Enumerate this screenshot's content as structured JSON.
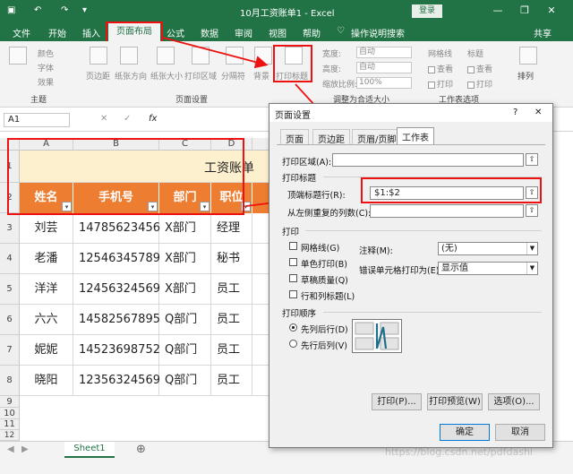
{
  "titlebar": {
    "title": "10月工资账单1  -  Excel",
    "login": "登录",
    "min": "—",
    "restore": "❐",
    "close": "✕"
  },
  "ribbon_tabs": [
    "文件",
    "开始",
    "插入",
    "页面布局",
    "公式",
    "数据",
    "审阅",
    "视图",
    "帮助",
    "操作说明搜索",
    "共享"
  ],
  "ribbon": {
    "theme_items": [
      "颜色",
      "字体",
      "效果",
      "主题"
    ],
    "page_setup_buttons": [
      "页边距",
      "纸张方向",
      "纸张大小",
      "打印区域",
      "分隔符",
      "背景",
      "打印标题"
    ],
    "page_setup_group": "页面设置",
    "scale_labels": [
      "宽度:",
      "高度:",
      "缩放比例:"
    ],
    "scale_values": [
      "自动",
      "自动",
      "100%"
    ],
    "scale_group": "调整为合适大小",
    "sheet_options": [
      "网格线",
      "标题",
      "查看",
      "查看",
      "打印",
      "打印"
    ],
    "sheet_group": "工作表选项",
    "arrange": "排列"
  },
  "formula_bar": {
    "namebox": "A1",
    "fx": "fx"
  },
  "columns": [
    "A",
    "B",
    "C",
    "D"
  ],
  "rows": [
    "1",
    "2",
    "3",
    "4",
    "5",
    "6",
    "7",
    "8",
    "9",
    "10",
    "11",
    "12",
    "13",
    "14"
  ],
  "sheet_title": "工资账单",
  "table_headers": [
    "姓名",
    "手机号",
    "部门",
    "职位"
  ],
  "table_rows": [
    [
      "刘芸",
      "14785623456",
      "X部门",
      "经理"
    ],
    [
      "老潘",
      "12546345789",
      "X部门",
      "秘书"
    ],
    [
      "洋洋",
      "12456324569",
      "X部门",
      "员工"
    ],
    [
      "六六",
      "14582567895",
      "Q部门",
      "员工"
    ],
    [
      "妮妮",
      "14523698752",
      "Q部门",
      "员工"
    ],
    [
      "晓阳",
      "12356324569",
      "Q部门",
      "员工"
    ]
  ],
  "sheet_tab": "Sheet1",
  "watermark": "https://blog.csdn.net/pdfdashi",
  "dialog": {
    "title": "页面设置",
    "tabs": [
      "页面",
      "页边距",
      "页眉/页脚",
      "工作表"
    ],
    "print_area_label": "打印区域(A):",
    "print_titles_label": "打印标题",
    "top_rows_label": "顶端标题行(R):",
    "top_rows_value": "$1:$2",
    "left_cols_label": "从左侧重复的列数(C):",
    "print_section": "打印",
    "checkboxes": [
      "网格线(G)",
      "单色打印(B)",
      "草稿质量(Q)",
      "行和列标题(L)"
    ],
    "comments_label": "注释(M):",
    "comments_value": "(无)",
    "errors_label": "错误单元格打印为(E):",
    "errors_value": "显示值",
    "order_section": "打印顺序",
    "order_options": [
      "先列后行(D)",
      "先行后列(V)"
    ],
    "print_btn": "打印(P)...",
    "preview_btn": "打印预览(W)",
    "options_btn": "选项(O)...",
    "ok_btn": "确定",
    "cancel_btn": "取消",
    "help": "?",
    "close": "✕"
  }
}
